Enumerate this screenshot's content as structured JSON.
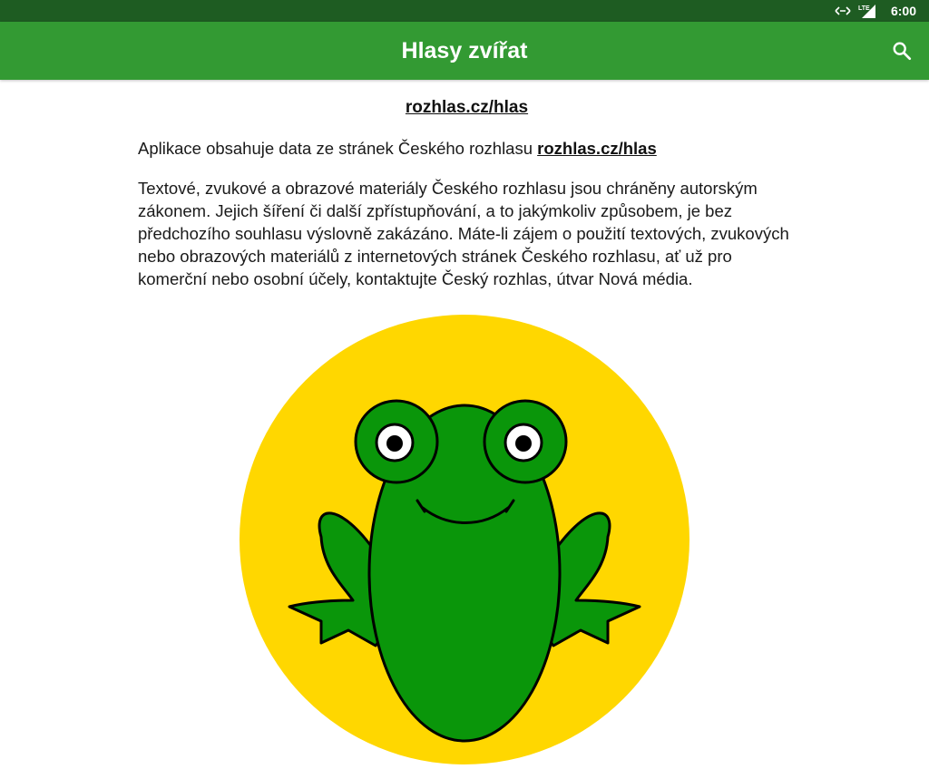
{
  "status_bar": {
    "time": "6:00",
    "network": "LTE",
    "icons": [
      "data-transfer-icon",
      "lte-signal-icon"
    ],
    "background": "#1e5c22"
  },
  "app_bar": {
    "title": "Hlasy zvířat",
    "background": "#339a33",
    "search_icon": "search-icon"
  },
  "content": {
    "header_link": "rozhlas.cz/hlas",
    "source_text": "Aplikace obsahuje data ze stránek Českého rozhlasu ",
    "source_link": "rozhlas.cz/hlas",
    "copyright_text": "Textové, zvukové a obrazové materiály Českého rozhlasu jsou chráněny autorským zákonem. Jejich šíření či další zpřístupňování, a to jakýmkoliv způsobem, je bez předchozího souhlasu výslovně zakázáno. Máte-li zájem o použití textových, zvukových nebo obrazových materiálů z internetových stránek Českého rozhlasu, ať už pro komerční nebo osobní účely, kontaktujte Český rozhlas, útvar Nová média."
  },
  "illustration": {
    "subject": "frog",
    "circle_color": "#ffd700",
    "frog_color": "#0a960a"
  }
}
